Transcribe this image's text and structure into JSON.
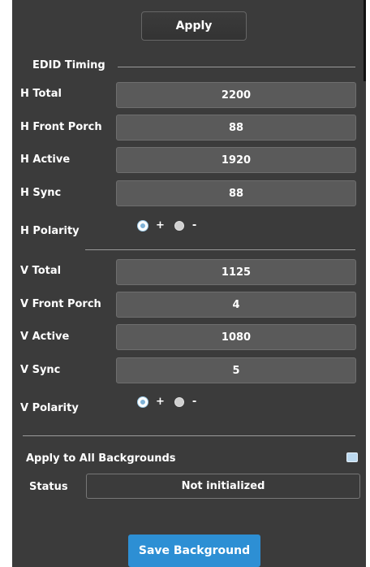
{
  "apply_button": "Apply",
  "edid": {
    "title": "EDID Timing",
    "h_total": {
      "label": "H Total",
      "value": "2200"
    },
    "h_front_porch": {
      "label": "H Front Porch",
      "value": "88"
    },
    "h_active": {
      "label": "H Active",
      "value": "1920"
    },
    "h_sync": {
      "label": "H Sync",
      "value": "88"
    },
    "h_polarity": {
      "label": "H Polarity",
      "plus": "+",
      "minus": "-",
      "selected": "+"
    },
    "v_total": {
      "label": "V Total",
      "value": "1125"
    },
    "v_front_porch": {
      "label": "V Front Porch",
      "value": "4"
    },
    "v_active": {
      "label": "V Active",
      "value": "1080"
    },
    "v_sync": {
      "label": "V Sync",
      "value": "5"
    },
    "v_polarity": {
      "label": "V Polarity",
      "plus": "+",
      "minus": "-",
      "selected": "+"
    }
  },
  "apply_all": {
    "label": "Apply to All Backgrounds",
    "checked": false
  },
  "status": {
    "label": "Status",
    "value": "Not initialized"
  },
  "save_button": "Save Background",
  "colors": {
    "panel": "#3b3b3b",
    "field": "#5a5a5a",
    "accent": "#2d8fd4"
  }
}
